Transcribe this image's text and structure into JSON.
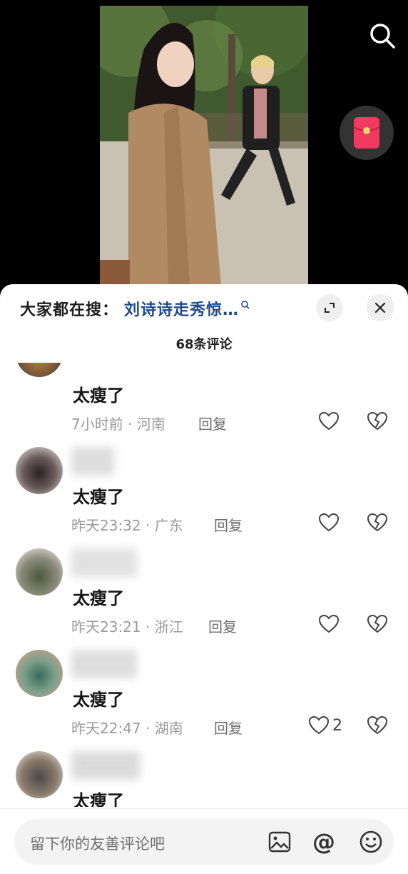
{
  "video": {
    "search_icon": "search-icon",
    "redpacket_icon": "red-packet-icon"
  },
  "panel": {
    "trending_prefix": "大家都在搜：",
    "trending_query": "刘诗诗走秀惊…",
    "comment_count": "68条评论",
    "expand_icon": "expand-icon",
    "close_icon": "close-icon"
  },
  "comments": [
    {
      "text": "太瘦了",
      "time": "7小时前",
      "location": "河南",
      "reply": "回复",
      "likes": ""
    },
    {
      "text": "太瘦了",
      "time": "昨天23:32",
      "location": "广东",
      "reply": "回复",
      "likes": ""
    },
    {
      "text": "太瘦了",
      "time": "昨天23:21",
      "location": "浙江",
      "reply": "回复",
      "likes": ""
    },
    {
      "text": "太瘦了",
      "time": "昨天22:47",
      "location": "湖南",
      "reply": "回复",
      "likes": "2"
    },
    {
      "text": "太瘦了"
    }
  ],
  "meta_separator": " · ",
  "input": {
    "placeholder": "留下你的友善评论吧",
    "image_icon": "image-icon",
    "at_icon": "at-icon",
    "at_glyph": "@",
    "emoji_icon": "emoji-icon"
  }
}
